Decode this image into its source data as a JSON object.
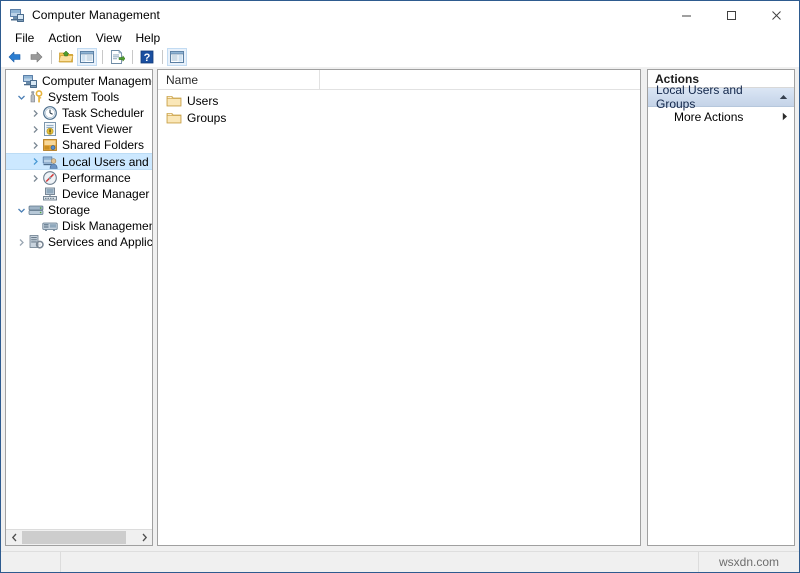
{
  "window": {
    "title": "Computer Management",
    "icon": "computer-management-icon",
    "controls": {
      "minimize": "minimize-icon",
      "maximize": "maximize-icon",
      "close": "close-icon"
    }
  },
  "menubar": {
    "items": [
      {
        "label": "File"
      },
      {
        "label": "Action"
      },
      {
        "label": "View"
      },
      {
        "label": "Help"
      }
    ]
  },
  "toolbar": {
    "buttons": [
      {
        "name": "back-button",
        "icon": "arrow-left-icon",
        "framed": false
      },
      {
        "name": "forward-button",
        "icon": "arrow-right-icon",
        "framed": false
      },
      {
        "name": "up-one-level-button",
        "icon": "folder-up-icon",
        "framed": false
      },
      {
        "name": "show-hide-console-tree-button",
        "icon": "console-tree-icon",
        "framed": true
      },
      {
        "name": "export-list-button",
        "icon": "export-list-icon",
        "framed": false
      },
      {
        "name": "help-button",
        "icon": "question-mark-icon",
        "framed": false
      },
      {
        "name": "show-hide-action-pane-button",
        "icon": "action-pane-icon",
        "framed": true
      }
    ]
  },
  "tree": {
    "nodes": [
      {
        "label": "Computer Management (Local",
        "icon": "computer-management-icon",
        "indent": 0,
        "expander": "none",
        "selected": false
      },
      {
        "label": "System Tools",
        "icon": "system-tools-icon",
        "indent": 1,
        "expander": "expanded",
        "selected": false
      },
      {
        "label": "Task Scheduler",
        "icon": "clock-icon",
        "indent": 2,
        "expander": "collapsed",
        "selected": false
      },
      {
        "label": "Event Viewer",
        "icon": "event-viewer-icon",
        "indent": 2,
        "expander": "collapsed",
        "selected": false
      },
      {
        "label": "Shared Folders",
        "icon": "shared-folders-icon",
        "indent": 2,
        "expander": "collapsed",
        "selected": false
      },
      {
        "label": "Local Users and Groups",
        "icon": "local-users-groups-icon",
        "indent": 2,
        "expander": "collapsed",
        "selected": true
      },
      {
        "label": "Performance",
        "icon": "performance-icon",
        "indent": 2,
        "expander": "collapsed",
        "selected": false
      },
      {
        "label": "Device Manager",
        "icon": "device-manager-icon",
        "indent": 2,
        "expander": "none",
        "selected": false
      },
      {
        "label": "Storage",
        "icon": "storage-icon",
        "indent": 1,
        "expander": "expanded",
        "selected": false
      },
      {
        "label": "Disk Management",
        "icon": "disk-management-icon",
        "indent": 2,
        "expander": "none",
        "selected": false
      },
      {
        "label": "Services and Applications",
        "icon": "services-applications-icon",
        "indent": 1,
        "expander": "collapsed",
        "selected": false
      }
    ],
    "scrollbar": {
      "left_arrow": "chevron-left-icon",
      "right_arrow": "chevron-right-icon"
    }
  },
  "list": {
    "columns": [
      {
        "label": "Name",
        "width": 162
      }
    ],
    "rows": [
      {
        "name": "Users",
        "icon": "folder-icon"
      },
      {
        "name": "Groups",
        "icon": "folder-icon"
      }
    ]
  },
  "actions": {
    "title": "Actions",
    "groups": [
      {
        "label": "Local Users and Groups",
        "collapse_icon": "chevron-up-icon",
        "items": [
          {
            "label": "More Actions",
            "submenu_icon": "chevron-right-icon"
          }
        ]
      }
    ]
  },
  "statusbar": {
    "watermark": "wsxdn.com"
  },
  "colors": {
    "window_border": "#2e5b8f",
    "selection": "#cce8ff",
    "action_header_bg": "#cfdcee",
    "folder_yellow": "#fcd77f",
    "chrome_bg": "#f0f0f0"
  }
}
